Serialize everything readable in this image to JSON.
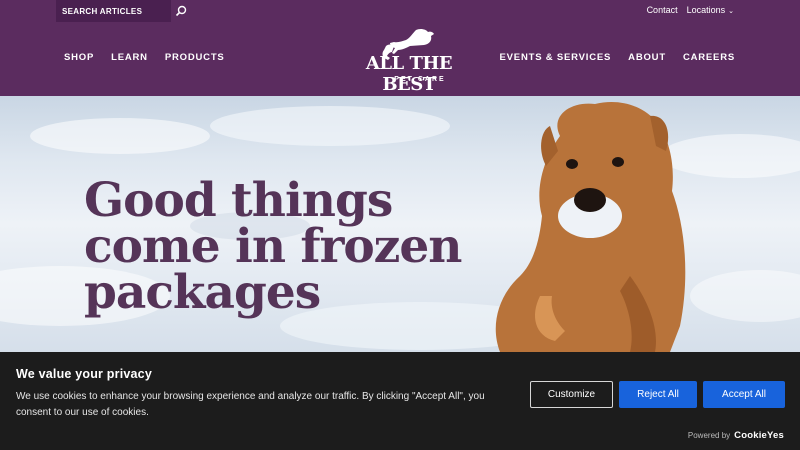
{
  "search": {
    "placeholder": "SEARCH ARTICLES"
  },
  "top_links": {
    "contact": "Contact",
    "locations": "Locations"
  },
  "nav_left": [
    "SHOP",
    "LEARN",
    "PRODUCTS"
  ],
  "nav_right": [
    "EVENTS & SERVICES",
    "ABOUT",
    "CAREERS"
  ],
  "logo": {
    "main": "ALL THE BEST",
    "sub": "PET CARE"
  },
  "hero": {
    "line1": "Good things",
    "line2": "come in frozen",
    "line3": "packages"
  },
  "cookie": {
    "title": "We value your privacy",
    "text": "We use cookies to enhance your browsing experience and analyze our traffic. By clicking \"Accept All\", you consent to our use of cookies.",
    "customize": "Customize",
    "reject": "Reject All",
    "accept": "Accept All",
    "powered_by": "Powered by",
    "brand": "CookieYes"
  },
  "colors": {
    "header": "#5b2c5f",
    "hero_text": "#553458",
    "button_blue": "#1863dc",
    "banner": "#1c1c1c"
  }
}
